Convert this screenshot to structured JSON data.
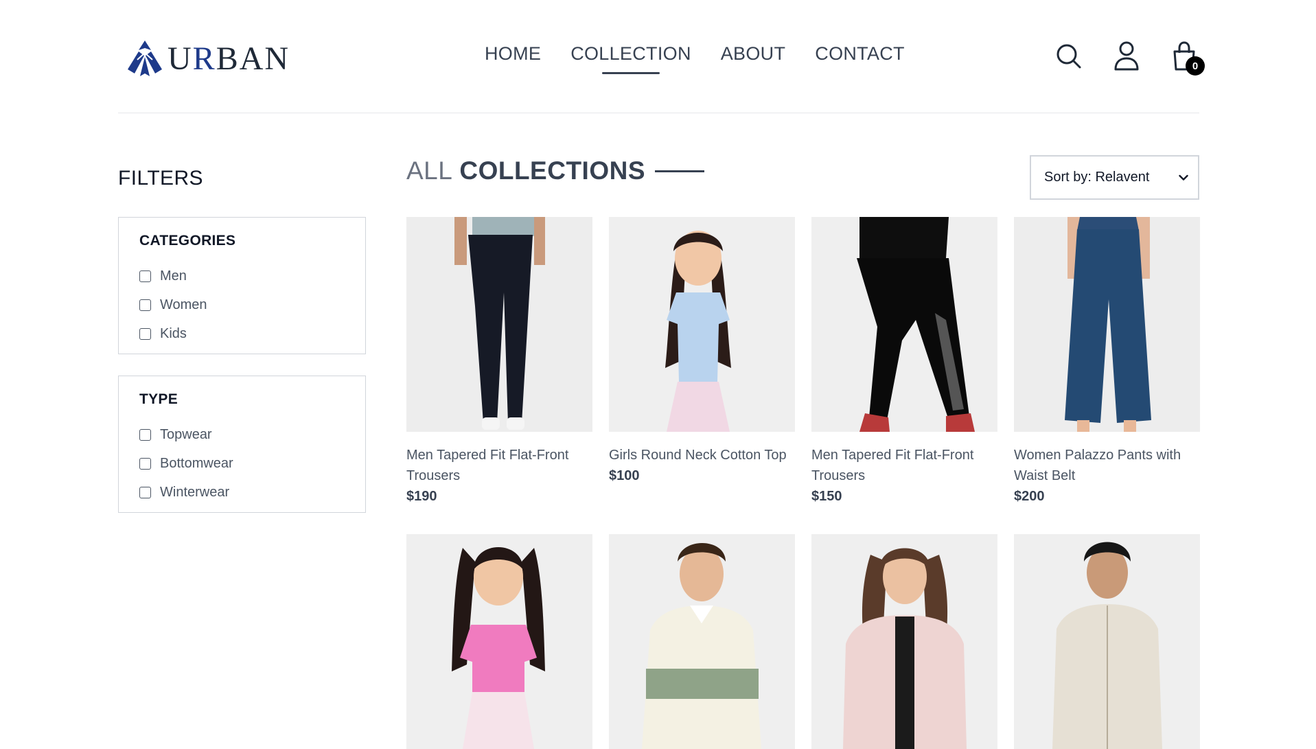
{
  "brand": {
    "logo_text_1": "U",
    "logo_text_accent": "R",
    "logo_text_2": "BAN"
  },
  "nav": [
    {
      "label": "HOME"
    },
    {
      "label": "COLLECTION",
      "active": true
    },
    {
      "label": "ABOUT"
    },
    {
      "label": "CONTACT"
    }
  ],
  "header_icons": [
    "search-icon",
    "user-icon",
    "cart-icon"
  ],
  "cart": {
    "count": "0"
  },
  "filters": {
    "title": "FILTERS",
    "categories": {
      "heading": "CATEGORIES",
      "options": [
        "Men",
        "Women",
        "Kids"
      ]
    },
    "type": {
      "heading": "TYPE",
      "options": [
        "Topwear",
        "Bottomwear",
        "Winterwear"
      ]
    }
  },
  "collections": {
    "title_light": "ALL",
    "title_bold": "COLLECTIONS",
    "sort": {
      "label": "Sort by: Relavent"
    }
  },
  "products": [
    {
      "name": "Men Tapered Fit Flat-Front Trousers",
      "price": "$190",
      "image": "dark-navy-trousers"
    },
    {
      "name": "Girls Round Neck Cotton Top",
      "price": "$100",
      "image": "girl-light-blue-top"
    },
    {
      "name": "Men Tapered Fit Flat-Front Trousers",
      "price": "$150",
      "image": "black-joggers"
    },
    {
      "name": "Women Palazzo Pants with Waist Belt",
      "price": "$200",
      "image": "blue-palazzo-pants"
    },
    {
      "name": "",
      "price": "",
      "image": "girl-pink-top"
    },
    {
      "name": "",
      "price": "",
      "image": "man-striped-sweatshirt"
    },
    {
      "name": "",
      "price": "",
      "image": "woman-pink-puffer-jacket"
    },
    {
      "name": "",
      "price": "",
      "image": "man-printed-shirt"
    }
  ],
  "colors": {
    "text": "#374151",
    "border": "#d1d5db",
    "accent": "#1e3a8a",
    "thumb_bg": "#ebebeb"
  }
}
